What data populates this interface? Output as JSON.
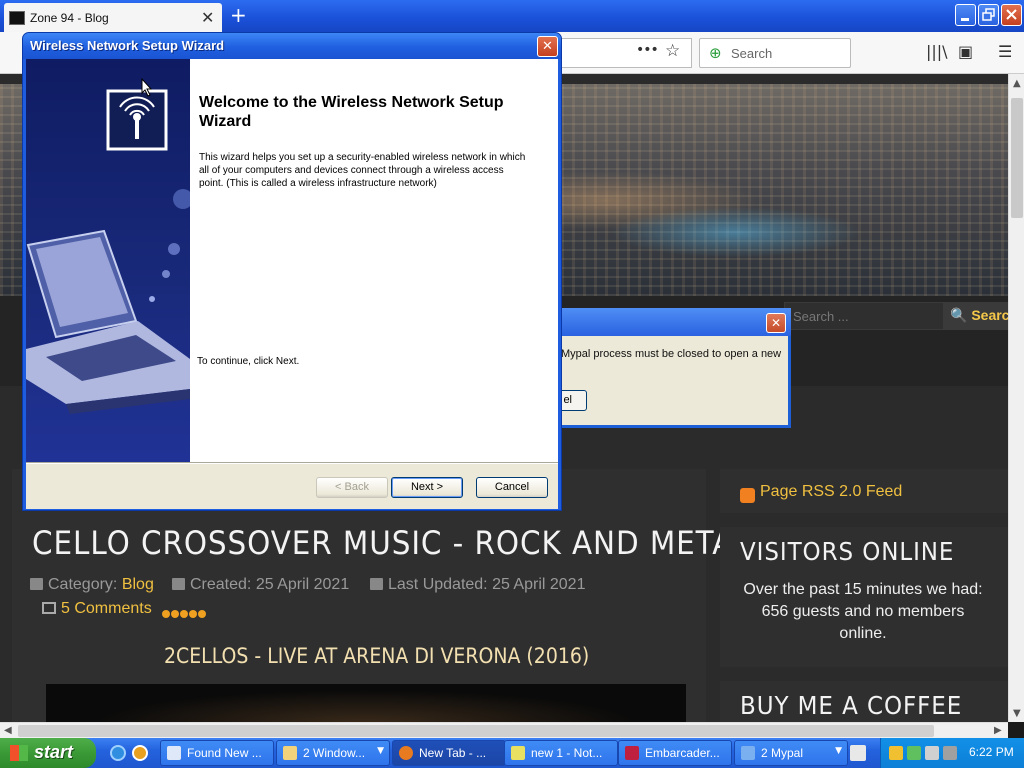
{
  "browser": {
    "tab_title": "Zone 94 - Blog",
    "tab_close": "✕",
    "new_tab": "+",
    "url_more": "•••",
    "search_placeholder": "Search"
  },
  "site": {
    "search_placeholder": "Search ...",
    "search_button": "Search"
  },
  "article": {
    "title": "CELLO CROSSOVER MUSIC - ROCK AND METAL",
    "category_label": "Category:",
    "category_link": "Blog",
    "created": "Created: 25 April 2021",
    "updated": "Last Updated: 25 April 2021",
    "comments": "5 Comments",
    "rating_value": 5,
    "video_title": "2CELLOS - LIVE AT ARENA DI VERONA (2016)"
  },
  "sidebar": {
    "rss": "Page RSS 2.0 Feed",
    "visitors_title": "VISITORS ONLINE",
    "visitors_text": "Over the past 15 minutes we had: 656 guests and no members online.",
    "coffee_title": "BUY ME A COFFEE"
  },
  "background_dialog": {
    "message": "Mypal process must be closed to open a new",
    "button_fragment": "el",
    "close": "✕"
  },
  "wizard": {
    "title": "Wireless Network Setup Wizard",
    "close": "✕",
    "heading": "Welcome to the Wireless Network Setup Wizard",
    "description": "This wizard helps you set up a security-enabled wireless network in which all of your computers and devices connect through a wireless access point. (This is called a wireless infrastructure network)",
    "continue_text": "To continue, click Next.",
    "back_button": "< Back",
    "next_button": "Next >",
    "cancel_button": "Cancel"
  },
  "taskbar": {
    "start": "start",
    "tasks": [
      {
        "label": "Found New ...",
        "icon": "window-icon"
      },
      {
        "label": "2 Window...",
        "icon": "folder-icon"
      },
      {
        "label": "New Tab - ...",
        "icon": "firefox-icon"
      },
      {
        "label": "new 1 - Not...",
        "icon": "notepad-icon"
      },
      {
        "label": "Embarcader...",
        "icon": "devcpp-icon"
      },
      {
        "label": "2 Mypal",
        "icon": "mypal-icon"
      }
    ],
    "clock": "6:22 PM"
  },
  "colors": {
    "xp_blue": "#2463de",
    "accent_gold": "#f0c040",
    "start_green": "#3a9a36"
  }
}
